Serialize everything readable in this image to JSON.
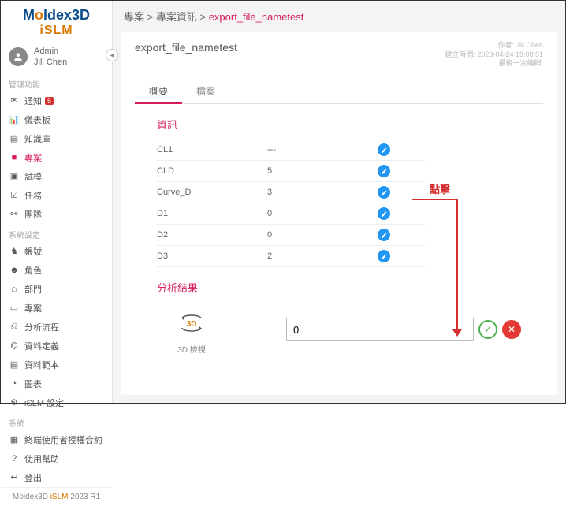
{
  "logo": {
    "text": "Moldex3D",
    "sub": "iSLM"
  },
  "user": {
    "role": "Admin",
    "name": "Jill Chen"
  },
  "sections": {
    "manage": "管理功能",
    "system": "系統設定",
    "sys": "系統"
  },
  "nav": {
    "notify": "通知",
    "notify_badge": "5",
    "dashboard": "儀表板",
    "knowledge": "知識庫",
    "project": "專案",
    "mold": "試模",
    "task": "任務",
    "team": "團隊",
    "account": "帳號",
    "role": "角色",
    "dept": "部門",
    "project2": "專案",
    "flow": "分析流程",
    "datadef": "資料定義",
    "template": "資料範本",
    "chart": "圖表",
    "islm": "iSLM 設定",
    "eula": "終端使用者授權合約",
    "help": "使用幫助",
    "logout": "登出"
  },
  "footer": {
    "prefix": "Moldex3D ",
    "mid": "iSLM",
    "suffix": " 2023 R1"
  },
  "breadcrumb": {
    "a": "專案",
    "b": "專案資訊",
    "c": "export_file_nametest"
  },
  "card": {
    "title": "export_file_nametest",
    "meta1": "作者: Jill Chen",
    "meta2": "建立時間: 2023-04-24 19:08:51",
    "meta3": "最後一次編輯:"
  },
  "tabs": {
    "overview": "概要",
    "files": "檔案"
  },
  "info_h": "資訊",
  "rows": [
    {
      "label": "CL1",
      "value": "---"
    },
    {
      "label": "CLD",
      "value": "5"
    },
    {
      "label": "Curve_D",
      "value": "3"
    },
    {
      "label": "D1",
      "value": "0"
    },
    {
      "label": "D2",
      "value": "0"
    },
    {
      "label": "D3",
      "value": "2"
    }
  ],
  "result_h": "分析結果",
  "result_3d": "3D",
  "result_view": "3D 檢視",
  "popup_value": "0",
  "annotation": "點擊"
}
